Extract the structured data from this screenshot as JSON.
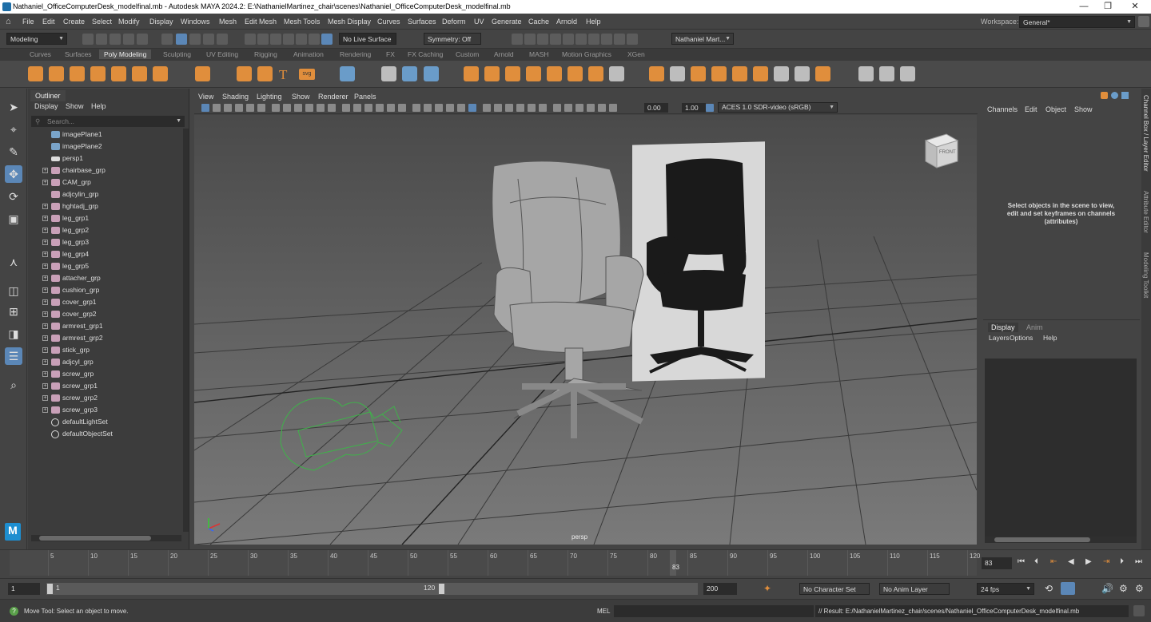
{
  "title_bar": {
    "text": "Nathaniel_OfficeComputerDesk_modelfinal.mb - Autodesk MAYA 2024.2: E:\\NathanielMartinez_chair\\scenes\\Nathaniel_OfficeComputerDesk_modelfinal.mb",
    "minimize": "—",
    "restore": "❐",
    "close": "✕"
  },
  "menu": [
    "File",
    "Edit",
    "Create",
    "Select",
    "Modify",
    "Display",
    "Windows",
    "Mesh",
    "Edit Mesh",
    "Mesh Tools",
    "Mesh Display",
    "Curves",
    "Surfaces",
    "Deform",
    "UV",
    "Generate",
    "Cache",
    "Arnold",
    "Help"
  ],
  "workspace": {
    "label": "Workspace:",
    "value": "General*"
  },
  "status_line": {
    "mode": "Modeling",
    "live_surface": "No Live Surface",
    "symmetry": "Symmetry: Off",
    "user": "Nathaniel Mart..."
  },
  "shelf_tabs": [
    "Curves",
    "Surfaces",
    "Poly Modeling",
    "Sculpting",
    "UV Editing",
    "Rigging",
    "Animation",
    "Rendering",
    "FX",
    "FX Caching",
    "Custom",
    "Arnold",
    "MASH",
    "Motion Graphics",
    "XGen"
  ],
  "shelf_active": "Poly Modeling",
  "shelf_text_icon": "T",
  "shelf_svg_icon": "svg",
  "outliner": {
    "tab": "Outliner",
    "menu": [
      "Display",
      "Show",
      "Help"
    ],
    "search_placeholder": "Search...",
    "items": [
      {
        "label": "imagePlane1",
        "type": "img",
        "expand": false
      },
      {
        "label": "imagePlane2",
        "type": "img",
        "expand": false
      },
      {
        "label": "persp1",
        "type": "cam",
        "expand": false
      },
      {
        "label": "chairbase_grp",
        "type": "grp",
        "expand": true
      },
      {
        "label": "CAM_grp",
        "type": "grp",
        "expand": true
      },
      {
        "label": "adjcylin_grp",
        "type": "grp",
        "expand": false
      },
      {
        "label": "hghtadj_grp",
        "type": "grp",
        "expand": true
      },
      {
        "label": "leg_grp1",
        "type": "grp",
        "expand": true
      },
      {
        "label": "leg_grp2",
        "type": "grp",
        "expand": true
      },
      {
        "label": "leg_grp3",
        "type": "grp",
        "expand": true
      },
      {
        "label": "leg_grp4",
        "type": "grp",
        "expand": true
      },
      {
        "label": "leg_grp5",
        "type": "grp",
        "expand": true
      },
      {
        "label": "attacher_grp",
        "type": "grp",
        "expand": true
      },
      {
        "label": "cushion_grp",
        "type": "grp",
        "expand": true
      },
      {
        "label": "cover_grp1",
        "type": "grp",
        "expand": true
      },
      {
        "label": "cover_grp2",
        "type": "grp",
        "expand": true
      },
      {
        "label": "armrest_grp1",
        "type": "grp",
        "expand": true
      },
      {
        "label": "armrest_grp2",
        "type": "grp",
        "expand": true
      },
      {
        "label": "stick_grp",
        "type": "grp",
        "expand": true
      },
      {
        "label": "adjcyl_grp",
        "type": "grp",
        "expand": true
      },
      {
        "label": "screw_grp",
        "type": "grp",
        "expand": true
      },
      {
        "label": "screw_grp1",
        "type": "grp",
        "expand": true
      },
      {
        "label": "screw_grp2",
        "type": "grp",
        "expand": true
      },
      {
        "label": "screw_grp3",
        "type": "grp",
        "expand": true
      },
      {
        "label": "defaultLightSet",
        "type": "set",
        "expand": false
      },
      {
        "label": "defaultObjectSet",
        "type": "set",
        "expand": false
      }
    ]
  },
  "viewport": {
    "menu": [
      "View",
      "Shading",
      "Lighting",
      "Show",
      "Renderer",
      "Panels"
    ],
    "exposure": "0.00",
    "gamma": "1.00",
    "color_space": "ACES 1.0 SDR-video (sRGB)",
    "camera_label": "persp",
    "viewcube_label": "FRONT"
  },
  "channel_box": {
    "menu": [
      "Channels",
      "Edit",
      "Object",
      "Show"
    ],
    "message": "Select objects in the scene to view, edit and set keyframes on channels (attributes)"
  },
  "layer_editor": {
    "tabs": [
      "Display",
      "Anim"
    ],
    "menu": [
      "Layers",
      "Options",
      "Help"
    ]
  },
  "side_tabs": [
    "Channel Box / Layer Editor",
    "Attribute Editor",
    "Modeling Toolkit"
  ],
  "timeline": {
    "ticks": [
      "5",
      "10",
      "15",
      "20",
      "25",
      "30",
      "35",
      "40",
      "45",
      "50",
      "55",
      "60",
      "65",
      "70",
      "75",
      "80",
      "85",
      "90",
      "95",
      "100",
      "105",
      "110",
      "115",
      "120"
    ],
    "current_frame_label": "83",
    "current_frame_field": "83"
  },
  "range": {
    "start": "1",
    "anim_start": "1",
    "range_end": "120",
    "anim_end": "200",
    "character_set": "No Character Set",
    "anim_layer": "No Anim Layer",
    "fps": "24 fps"
  },
  "help_line": {
    "text": "Move Tool: Select an object to move.",
    "mel_label": "MEL",
    "result": "// Result: E:/NathanielMartinez_chair/scenes/Nathaniel_OfficeComputerDesk_modelfinal.mb"
  },
  "maya_logo_text": "M",
  "colors": {
    "accent_blue": "#5b87b7",
    "shelf_orange": "#e08e3c",
    "outline_pink": "#c9a0b8",
    "camera_green": "#4caf50"
  }
}
